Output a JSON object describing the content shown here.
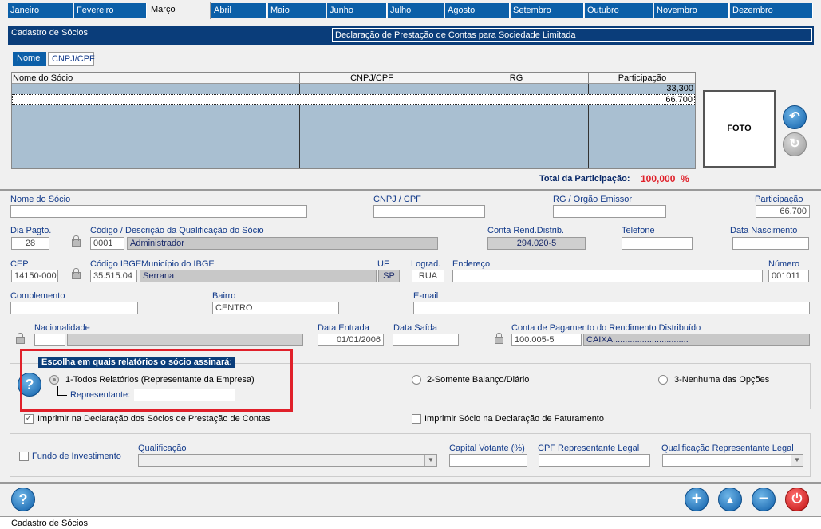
{
  "months": [
    "Janeiro",
    "Fevereiro",
    "Março",
    "Abril",
    "Maio",
    "Junho",
    "Julho",
    "Agosto",
    "Setembro",
    "Outubro",
    "Novembro",
    "Dezembro"
  ],
  "active_month": "Março",
  "header": {
    "left": "Cadastro de Sócios",
    "right": "Declaração de Prestação de Contas para Sociedade Limitada"
  },
  "subtabs": [
    "Nome",
    "CNPJ/CPF"
  ],
  "grid": {
    "columns": [
      "Nome do Sócio",
      "CNPJ/CPF",
      "RG",
      "Participação"
    ],
    "rows": [
      {
        "participacao": "33,300"
      },
      {
        "participacao": "66,700"
      }
    ]
  },
  "foto": "FOTO",
  "total": {
    "label": "Total da Participação:",
    "value": "100,000",
    "unit": "%"
  },
  "form": {
    "nome_label": "Nome do Sócio",
    "nome": "",
    "cnpj_label": "CNPJ / CPF",
    "cnpj": "",
    "rg_label": "RG / Orgão Emissor",
    "rg": "",
    "part_label": "Participação",
    "part": "66,700",
    "dia_label": "Dia Pagto.",
    "dia": "28",
    "cod_label": "Código  /  Descrição da Qualificação do Sócio",
    "cod": "0001",
    "cod_desc": "Administrador",
    "conta_label": "Conta Rend.Distrib.",
    "conta": "294.020-5",
    "tel_label": "Telefone",
    "tel": "",
    "nasc_label": "Data Nascimento",
    "nasc": "",
    "cep_label": "CEP",
    "cep": "14150-000",
    "ibge_label": "Código IBGE",
    "ibge": "35.515.04",
    "mun_label": "Município do IBGE",
    "mun": "Serrana",
    "uf_label": "UF",
    "uf": "SP",
    "lograd_label": "Lograd.",
    "lograd": "RUA",
    "end_label": "Endereço",
    "end": "",
    "num_label": "Número",
    "num": "001011",
    "compl_label": "Complemento",
    "compl": "",
    "bairro_label": "Bairro",
    "bairro": "CENTRO",
    "email_label": "E-mail",
    "email": "",
    "nac_label": "Nacionalidade",
    "nac": "",
    "entrada_label": "Data Entrada",
    "entrada": "01/01/2006",
    "saida_label": "Data Saída",
    "saida": "",
    "contapag_label": "Conta de Pagamento do Rendimento Distribuído",
    "contapag": "100.005-5",
    "contapag_desc": "CAIXA..............................."
  },
  "assina": {
    "title": "Escolha  em  quais  relatórios  o sócio assinará:",
    "opt1": "1-Todos Relatórios (Representante da Empresa)",
    "rep_label": "Representante:",
    "opt2": "2-Somente Balanço/Diário",
    "opt3": "3-Nenhuma das Opções"
  },
  "checks": {
    "imprimir_decl": "Imprimir na Declaração dos Sócios de Prestação de Contas",
    "imprimir_fat": "Imprimir Sócio na Declaração de Faturamento"
  },
  "fundo": {
    "label": "Fundo de Investimento",
    "qual_label": "Qualificação",
    "capital_label": "Capital Votante (%)",
    "cpf_label": "CPF Representante Legal",
    "qualrep_label": "Qualificação Representante Legal"
  },
  "status": "Cadastro de Sócios",
  "colors": {
    "blue": "#0b5fa8",
    "dark_blue": "#0a3d7a",
    "red": "#e0202a",
    "grid": "#a9bfd1"
  }
}
